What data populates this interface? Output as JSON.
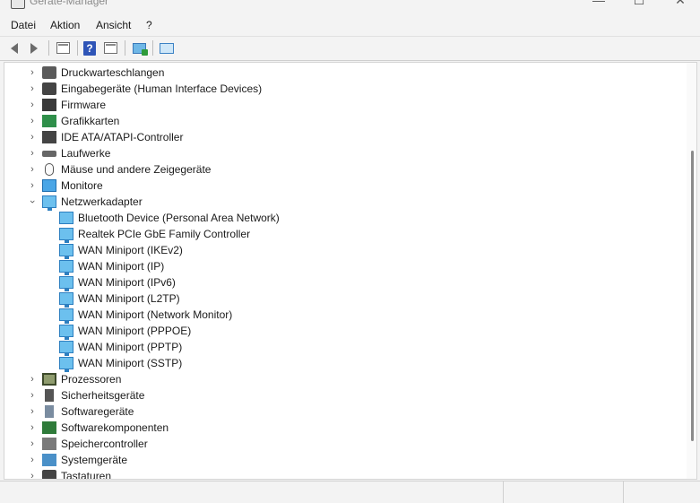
{
  "window": {
    "title": "Geräte-Manager"
  },
  "menu": [
    "Datei",
    "Aktion",
    "Ansicht",
    "?"
  ],
  "toolbar": {
    "buttons": [
      "back-icon",
      "forward-icon",
      "properties-icon",
      "help-icon",
      "view-icon",
      "update-driver-icon",
      "scan-hardware-icon"
    ]
  },
  "tree": {
    "top_items": [
      {
        "label": "Druckwarteschlangen",
        "expanded": false
      },
      {
        "label": "Eingabegeräte (Human Interface Devices)",
        "expanded": false
      },
      {
        "label": "Firmware",
        "expanded": false
      },
      {
        "label": "Grafikkarten",
        "expanded": false
      },
      {
        "label": "IDE ATA/ATAPI-Controller",
        "expanded": false
      },
      {
        "label": "Laufwerke",
        "expanded": false
      },
      {
        "label": "Mäuse und andere Zeigegeräte",
        "expanded": false
      },
      {
        "label": "Monitore",
        "expanded": false
      },
      {
        "label": "Netzwerkadapter",
        "expanded": true
      }
    ],
    "network_children": [
      "Bluetooth Device (Personal Area Network)",
      "Realtek PCIe GbE Family Controller",
      "WAN Miniport (IKEv2)",
      "WAN Miniport (IP)",
      "WAN Miniport (IPv6)",
      "WAN Miniport (L2TP)",
      "WAN Miniport (Network Monitor)",
      "WAN Miniport (PPPOE)",
      "WAN Miniport (PPTP)",
      "WAN Miniport (SSTP)"
    ],
    "bottom_items": [
      {
        "label": "Prozessoren",
        "expanded": false
      },
      {
        "label": "Sicherheitsgeräte",
        "expanded": false
      },
      {
        "label": "Softwaregeräte",
        "expanded": false
      },
      {
        "label": "Softwarekomponenten",
        "expanded": false
      },
      {
        "label": "Speichercontroller",
        "expanded": false
      },
      {
        "label": "Systemgeräte",
        "expanded": false
      },
      {
        "label": "Tastaturen",
        "expanded": false
      }
    ]
  },
  "status": {
    "text": ""
  }
}
